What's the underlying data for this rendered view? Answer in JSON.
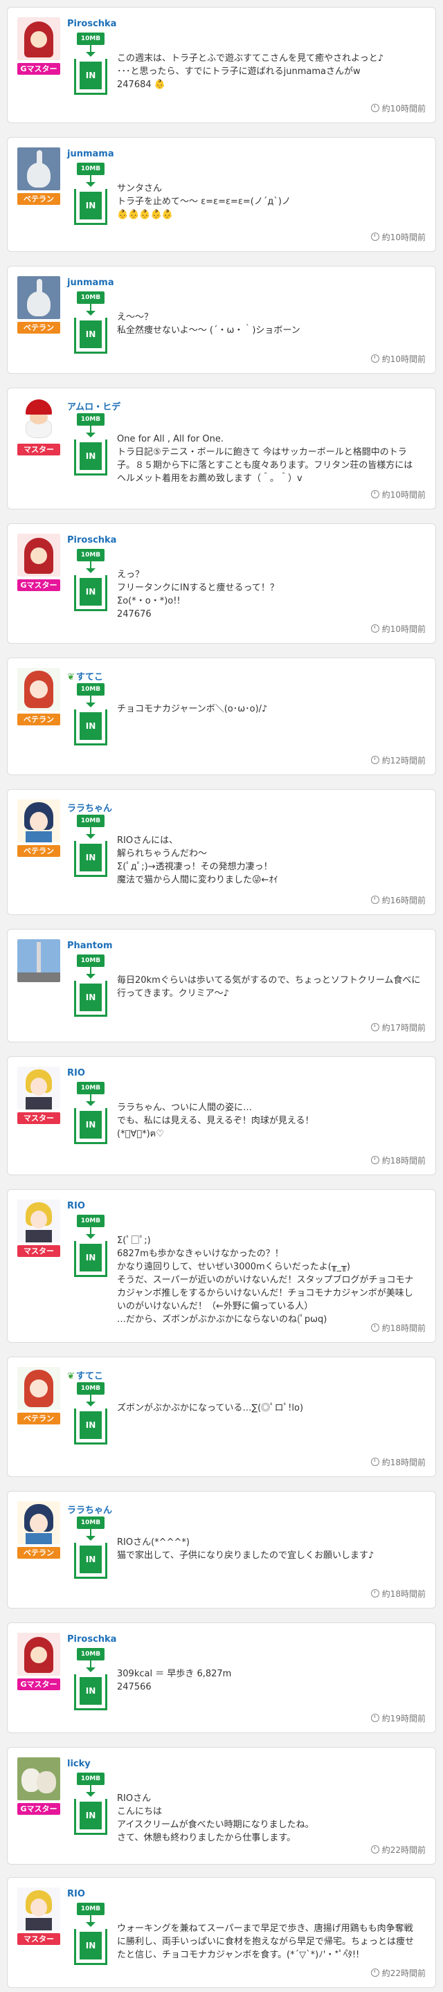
{
  "cards": [
    {
      "user": "Piroschka",
      "rank": "Gマスター",
      "rank_color": "#e6169a",
      "avatar": "red-hood-avatar",
      "mb": "10MB",
      "in": "IN",
      "lines": [
        "この週末は、トラ子とふで遊ぶすてこさんを見て癒やされよっと♪",
        "･･･と思ったら、すでにトラ子に遊ばれるjunmamaさんがw",
        "247684 👶"
      ],
      "time": "約10時間前"
    },
    {
      "user": "junmama",
      "rank": "ベテラン",
      "rank_color": "#f08a1c",
      "avatar": "swan-avatar",
      "mb": "10MB",
      "in": "IN",
      "lines": [
        "サンタさん",
        "トラ子を止めて〜〜 ε=ε=ε=ε=(ノ´д`)ノ",
        "👶👶👶👶👶"
      ],
      "time": "約10時間前"
    },
    {
      "user": "junmama",
      "rank": "ベテラン",
      "rank_color": "#f08a1c",
      "avatar": "swan-avatar",
      "mb": "10MB",
      "in": "IN",
      "lines": [
        "え〜〜？",
        "私全然痩せないよ〜〜 (´・ω・｀)ショボーン"
      ],
      "time": "約10時間前"
    },
    {
      "user": "アムロ・ヒデ",
      "rank": "マスター",
      "rank_color": "#e8344c",
      "avatar": "santa-avatar",
      "mb": "10MB",
      "in": "IN",
      "lines": [
        "One for All , All for One.",
        "トラ日記⑤テニス・ボールに飽きて 今はサッカーボールと格闘中のトラ子。８５期から下に落とすことも度々あります。フリタン荘の皆様方には ヘルメット着用をお薦め致します（＾。＾）v"
      ],
      "time": "約10時間前"
    },
    {
      "user": "Piroschka",
      "rank": "Gマスター",
      "rank_color": "#e6169a",
      "avatar": "red-hood-avatar",
      "mb": "10MB",
      "in": "IN",
      "lines": [
        "えっ？",
        "フリータンクにINすると痩せるって！？",
        "Σo(*・o・*)o!!",
        "247676"
      ],
      "time": "約10時間前"
    },
    {
      "user": "すてこ",
      "leaf": true,
      "rank": "ベテラン",
      "rank_color": "#f08a1c",
      "avatar": "anime-red-hair-avatar",
      "mb": "10MB",
      "in": "IN",
      "lines": [
        "チョコモナカジャーンボ＼(o･ω･o)/♪"
      ],
      "time": "約12時間前"
    },
    {
      "user": "ララちゃん",
      "rank": "ベテラン",
      "rank_color": "#f08a1c",
      "avatar": "anime-blue-hair-avatar",
      "mb": "10MB",
      "in": "IN",
      "lines": [
        "RIOさんには、",
        "解られちゃうんだわ〜",
        "Σ(ﾟдﾟ;)→透視凄っ！その発想力凄っ！",
        "魔法で猫から人間に変わりました😜←ｵｲ"
      ],
      "time": "約16時間前"
    },
    {
      "user": "Phantom",
      "rank": "",
      "rank_color": "",
      "avatar": "tower-avatar",
      "mb": "10MB",
      "in": "IN",
      "lines": [
        "毎日20kmぐらいは歩いてる気がするので、ちょっとソフトクリーム食べに行ってきます。クリミア〜♪"
      ],
      "time": "約17時間前"
    },
    {
      "user": "RIO",
      "rank": "マスター",
      "rank_color": "#e8344c",
      "avatar": "anime-yellow-hair-avatar",
      "mb": "10MB",
      "in": "IN",
      "lines": [
        "ララちゃん、ついに人間の姿に…",
        "でも、私には見える、見えるぞ！肉球が見える！",
        "(*ﾟ∀ﾟ*)ฅ♡"
      ],
      "time": "約18時間前"
    },
    {
      "user": "RIO",
      "rank": "マスター",
      "rank_color": "#e8344c",
      "avatar": "anime-yellow-hair-avatar",
      "mb": "10MB",
      "in": "IN",
      "lines": [
        "Σ(ﾟ□ﾟ;)",
        "6827mも歩かなきゃいけなかったの？！",
        "かなり遠回りして、せいぜい3000mくらいだったよ(╥_╥)",
        "そうだ、スーパーが近いのがいけないんだ！スタップブログがチョコモナカジャンボ推しをするからいけないんだ！チョコモナカジャンボが美味しいのがいけないんだ！（←外野に偏っている人）",
        "…だから、ズボンがぶかぶかにならないのね(ﾟpωq)"
      ],
      "time": "約18時間前"
    },
    {
      "user": "すてこ",
      "leaf": true,
      "rank": "ベテラン",
      "rank_color": "#f08a1c",
      "avatar": "anime-red-hair-avatar",
      "mb": "10MB",
      "in": "IN",
      "lines": [
        "ズボンがぶかぶかになっている…∑(◎ﾟロﾟ!lo)"
      ],
      "time": "約18時間前"
    },
    {
      "user": "ララちゃん",
      "rank": "ベテラン",
      "rank_color": "#f08a1c",
      "avatar": "anime-blue-hair-avatar",
      "mb": "10MB",
      "in": "IN",
      "lines": [
        "RIOさん(*^^^*)",
        "猫で家出して、子供になり戻りましたので宜しくお願いします♪"
      ],
      "time": "約18時間前"
    },
    {
      "user": "Piroschka",
      "rank": "Gマスター",
      "rank_color": "#e6169a",
      "avatar": "red-hood-avatar",
      "mb": "10MB",
      "in": "IN",
      "lines": [
        "309kcal ＝ 早歩き 6,827m",
        "247566"
      ],
      "time": "約19時間前"
    },
    {
      "user": "licky",
      "rank": "Gマスター",
      "rank_color": "#e6169a",
      "avatar": "dogs-avatar",
      "mb": "10MB",
      "in": "IN",
      "lines": [
        "RIOさん",
        "こんにちは",
        "アイスクリームが食べたい時期になりましたね。",
        "さて、休憩も終わりましたから仕事します。"
      ],
      "time": "約22時間前"
    },
    {
      "user": "RIO",
      "rank": "マスター",
      "rank_color": "#e8344c",
      "avatar": "anime-yellow-hair-avatar",
      "mb": "10MB",
      "in": "IN",
      "lines": [
        "ウォーキングを兼ねてスーパーまで早足で歩き、唐揚げ用鶏もも肉争奪戦に勝利し、両手いっぱいに食材を抱えながら早足で帰宅。ちょっとは痩せたと信じ、チョコモナカジャンボを食す。(*´▽`*)ﾉ'・*ﾟﾍ゚ﾀ!!"
      ],
      "time": "約22時間前"
    }
  ]
}
